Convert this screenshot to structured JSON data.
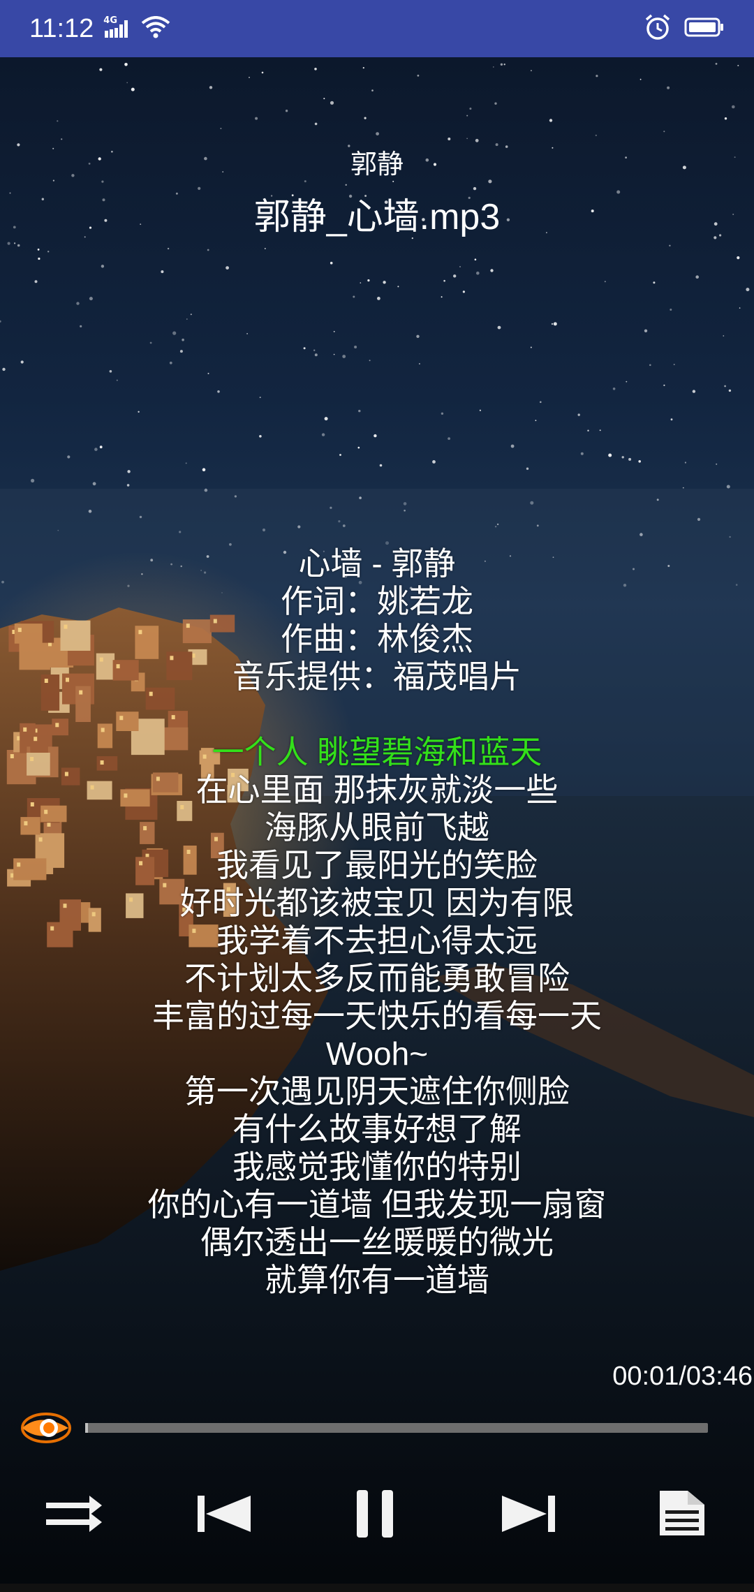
{
  "status_bar": {
    "time": "11:12",
    "network_label": "4G",
    "icons": [
      "signal-icon",
      "wifi-icon",
      "alarm-icon",
      "battery-icon"
    ]
  },
  "header": {
    "artist": "郭静",
    "title": "郭静_心墙.mp3"
  },
  "lyrics": {
    "intro": [
      "心墙 - 郭静",
      "作词：姚若龙",
      "作曲：林俊杰",
      "音乐提供：福茂唱片"
    ],
    "current": "一个人 眺望碧海和蓝天",
    "lines": [
      "在心里面 那抹灰就淡一些",
      "海豚从眼前飞越",
      "我看见了最阳光的笑脸",
      "好时光都该被宝贝 因为有限",
      "我学着不去担心得太远",
      "不计划太多反而能勇敢冒险",
      "丰富的过每一天快乐的看每一天",
      "Wooh~",
      "第一次遇见阴天遮住你侧脸",
      "有什么故事好想了解",
      "我感觉我懂你的特别",
      "你的心有一道墙 但我发现一扇窗",
      "偶尔透出一丝暖暖的微光",
      "就算你有一道墙"
    ],
    "current_color": "#33e01a"
  },
  "playback": {
    "time_display": "00:01/03:46",
    "progress_fraction": 0.004
  },
  "controls": {
    "shuffle": "shuffle-icon",
    "previous": "previous-icon",
    "pause": "pause-icon",
    "next": "next-icon",
    "playlist": "playlist-icon"
  },
  "colors": {
    "status_bar": "#3848a6",
    "accent": "#ff7a00"
  }
}
